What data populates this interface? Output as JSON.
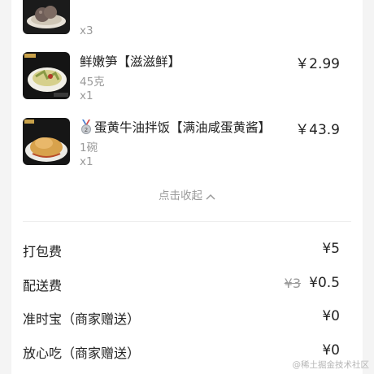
{
  "items": [
    {
      "name": "",
      "spec": "",
      "qty": "x3",
      "price": "",
      "thumb_icon": "meatball-dish-image"
    },
    {
      "name": "鲜嫩笋【滋滋鲜】",
      "spec": "45克",
      "qty": "x1",
      "price": "￥2.99",
      "thumb_icon": "bamboo-shoot-dish-image"
    },
    {
      "name": "蛋黄牛油拌饭【满油咸蛋黄酱】",
      "spec": "1碗",
      "qty": "x1",
      "price": "￥43.9",
      "thumb_icon": "egg-yolk-rice-image",
      "badge_icon": "silver-medal-2-icon"
    }
  ],
  "collapse_label": "点击收起",
  "fees": [
    {
      "label": "打包费",
      "value": "¥5"
    },
    {
      "label": "配送费",
      "original": "¥3",
      "value": "¥0.5"
    },
    {
      "label": "准时宝（商家赠送）",
      "value": "¥0"
    },
    {
      "label": "放心吃（商家赠送）",
      "value": "¥0"
    }
  ],
  "watermark": "@稀土掘金技术社区",
  "colors": {
    "background": "#f4f4f4",
    "card": "#ffffff",
    "text": "#222222",
    "muted": "#9a9a9a"
  }
}
